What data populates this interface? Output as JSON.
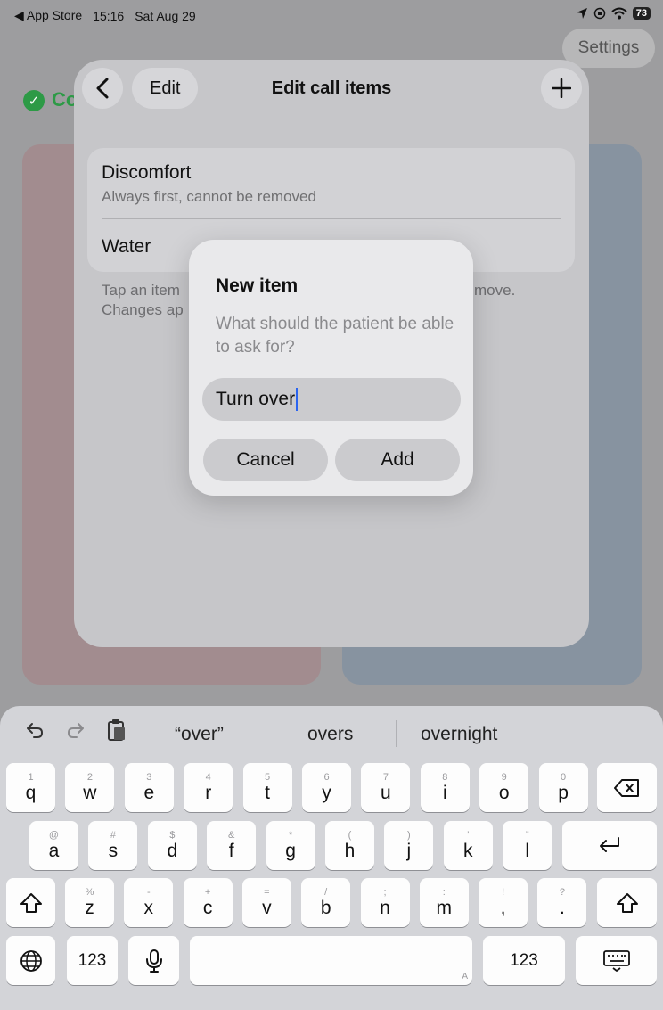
{
  "status_bar": {
    "back_app": "◀ App Store",
    "time": "15:16",
    "date": "Sat Aug 29",
    "battery": "73"
  },
  "background": {
    "settings_label": "Settings",
    "status_prefix": "Co"
  },
  "sheet": {
    "edit_label": "Edit",
    "title": "Edit call items",
    "items": [
      {
        "title": "Discomfort",
        "subtitle": "Always first, cannot be removed"
      },
      {
        "title": "Water",
        "subtitle": ""
      }
    ],
    "footnote_line1_a": "Tap an item",
    "footnote_line1_b": "move.",
    "footnote_line2_a": "Changes ap"
  },
  "dialog": {
    "title": "New item",
    "message": "What should the patient be able to ask for?",
    "input_value": "Turn over",
    "cancel_label": "Cancel",
    "add_label": "Add"
  },
  "keyboard": {
    "suggestions": [
      "“over”",
      "overs",
      "overnight"
    ],
    "row1": [
      {
        "hint": "1",
        "key": "q"
      },
      {
        "hint": "2",
        "key": "w"
      },
      {
        "hint": "3",
        "key": "e"
      },
      {
        "hint": "4",
        "key": "r"
      },
      {
        "hint": "5",
        "key": "t"
      },
      {
        "hint": "6",
        "key": "y"
      },
      {
        "hint": "7",
        "key": "u"
      },
      {
        "hint": "8",
        "key": "i"
      },
      {
        "hint": "9",
        "key": "o"
      },
      {
        "hint": "0",
        "key": "p"
      }
    ],
    "row2": [
      {
        "hint": "@",
        "key": "a"
      },
      {
        "hint": "#",
        "key": "s"
      },
      {
        "hint": "$",
        "key": "d"
      },
      {
        "hint": "&",
        "key": "f"
      },
      {
        "hint": "*",
        "key": "g"
      },
      {
        "hint": "(",
        "key": "h"
      },
      {
        "hint": ")",
        "key": "j"
      },
      {
        "hint": "’",
        "key": "k"
      },
      {
        "hint": "”",
        "key": "l"
      }
    ],
    "row3": [
      {
        "hint": "%",
        "key": "z"
      },
      {
        "hint": "-",
        "key": "x"
      },
      {
        "hint": "+",
        "key": "c"
      },
      {
        "hint": "=",
        "key": "v"
      },
      {
        "hint": "/",
        "key": "b"
      },
      {
        "hint": ";",
        "key": "n"
      },
      {
        "hint": ":",
        "key": "m"
      },
      {
        "hint": "!",
        "key": ","
      },
      {
        "hint": "?",
        "key": "."
      }
    ],
    "numbers_label": "123",
    "space_hint": "A"
  }
}
